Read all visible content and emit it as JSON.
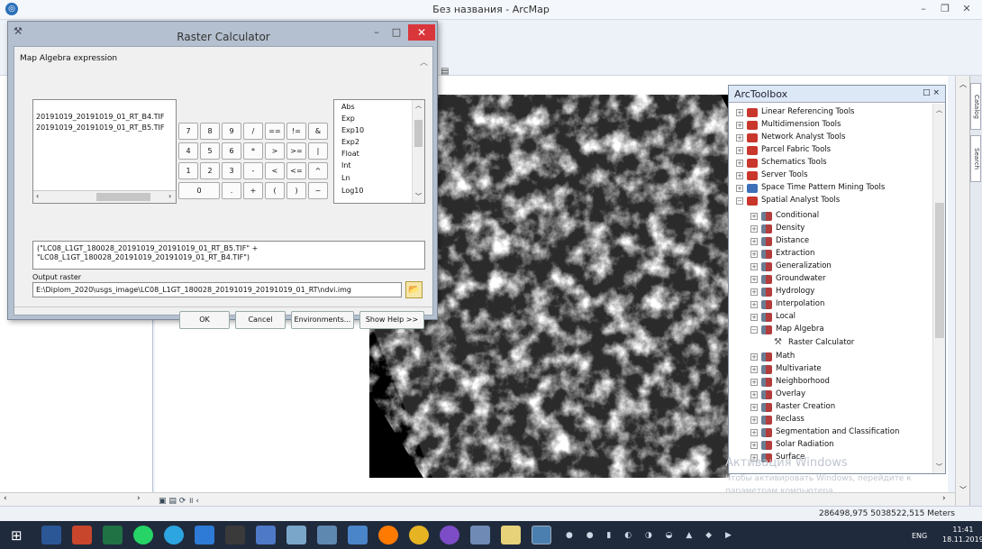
{
  "app": {
    "title": "Без названия - ArcMap"
  },
  "dialog": {
    "title": "Raster Calculator",
    "map_algebra_label": "Map Algebra expression",
    "layers": [
      "20191019_20191019_01_RT_B4.TIF",
      "20191019_20191019_01_RT_B5.TIF"
    ],
    "calc_buttons": [
      [
        "7",
        "8",
        "9",
        "/",
        "==",
        "!=",
        "&"
      ],
      [
        "4",
        "5",
        "6",
        "*",
        ">",
        ">=",
        "|"
      ],
      [
        "1",
        "2",
        "3",
        "-",
        "<",
        "<=",
        "^"
      ],
      [
        "0",
        ".",
        "+",
        "(",
        ")",
        "~"
      ]
    ],
    "functions": [
      "Abs",
      "Exp",
      "Exp10",
      "Exp2",
      "Float",
      "Int",
      "Ln",
      "Log10"
    ],
    "expression_line1": "(\"LC08_L1GT_180028_20191019_20191019_01_RT_B5.TIF\" +",
    "expression_line2": "\"LC08_L1GT_180028_20191019_20191019_01_RT_B4.TIF\")",
    "output_label": "Output raster",
    "output_value": "E:\\Diplom_2020\\usgs_image\\LC08_L1GT_180028_20191019_20191019_01_RT\\ndvi.img",
    "buttons": {
      "ok": "OK",
      "cancel": "Cancel",
      "environments": "Environments...",
      "help": "Show Help >>"
    }
  },
  "toolbox": {
    "title": "ArcToolbox",
    "controls": "□ ×",
    "top_items": [
      "Linear Referencing Tools",
      "Multidimension Tools",
      "Network Analyst Tools",
      "Parcel Fabric Tools",
      "Schematics Tools",
      "Server Tools",
      "Space Time Pattern Mining Tools",
      "Spatial Analyst Tools"
    ],
    "spatial_items_before": [
      "Conditional",
      "Density",
      "Distance",
      "Extraction",
      "Generalization",
      "Groundwater",
      "Hydrology",
      "Interpolation",
      "Local",
      "Map Algebra"
    ],
    "map_algebra_child": "Raster Calculator",
    "spatial_items_after": [
      "Math",
      "Multivariate",
      "Neighborhood",
      "Overlay",
      "Raster Creation",
      "Reclass",
      "Segmentation and Classification",
      "Solar Radiation",
      "Surface"
    ]
  },
  "watermark": {
    "line1": "Активация Windows",
    "line2": "Чтобы активировать Windows, перейдите к",
    "line3": "параметрам компьютера."
  },
  "side_tabs": [
    "Catalog",
    "Search"
  ],
  "status": {
    "coordinates": "286498,975  5038522,515 Meters"
  },
  "taskbar": {
    "lang": "ENG",
    "time": "11:41",
    "date": "18.11.2019"
  }
}
